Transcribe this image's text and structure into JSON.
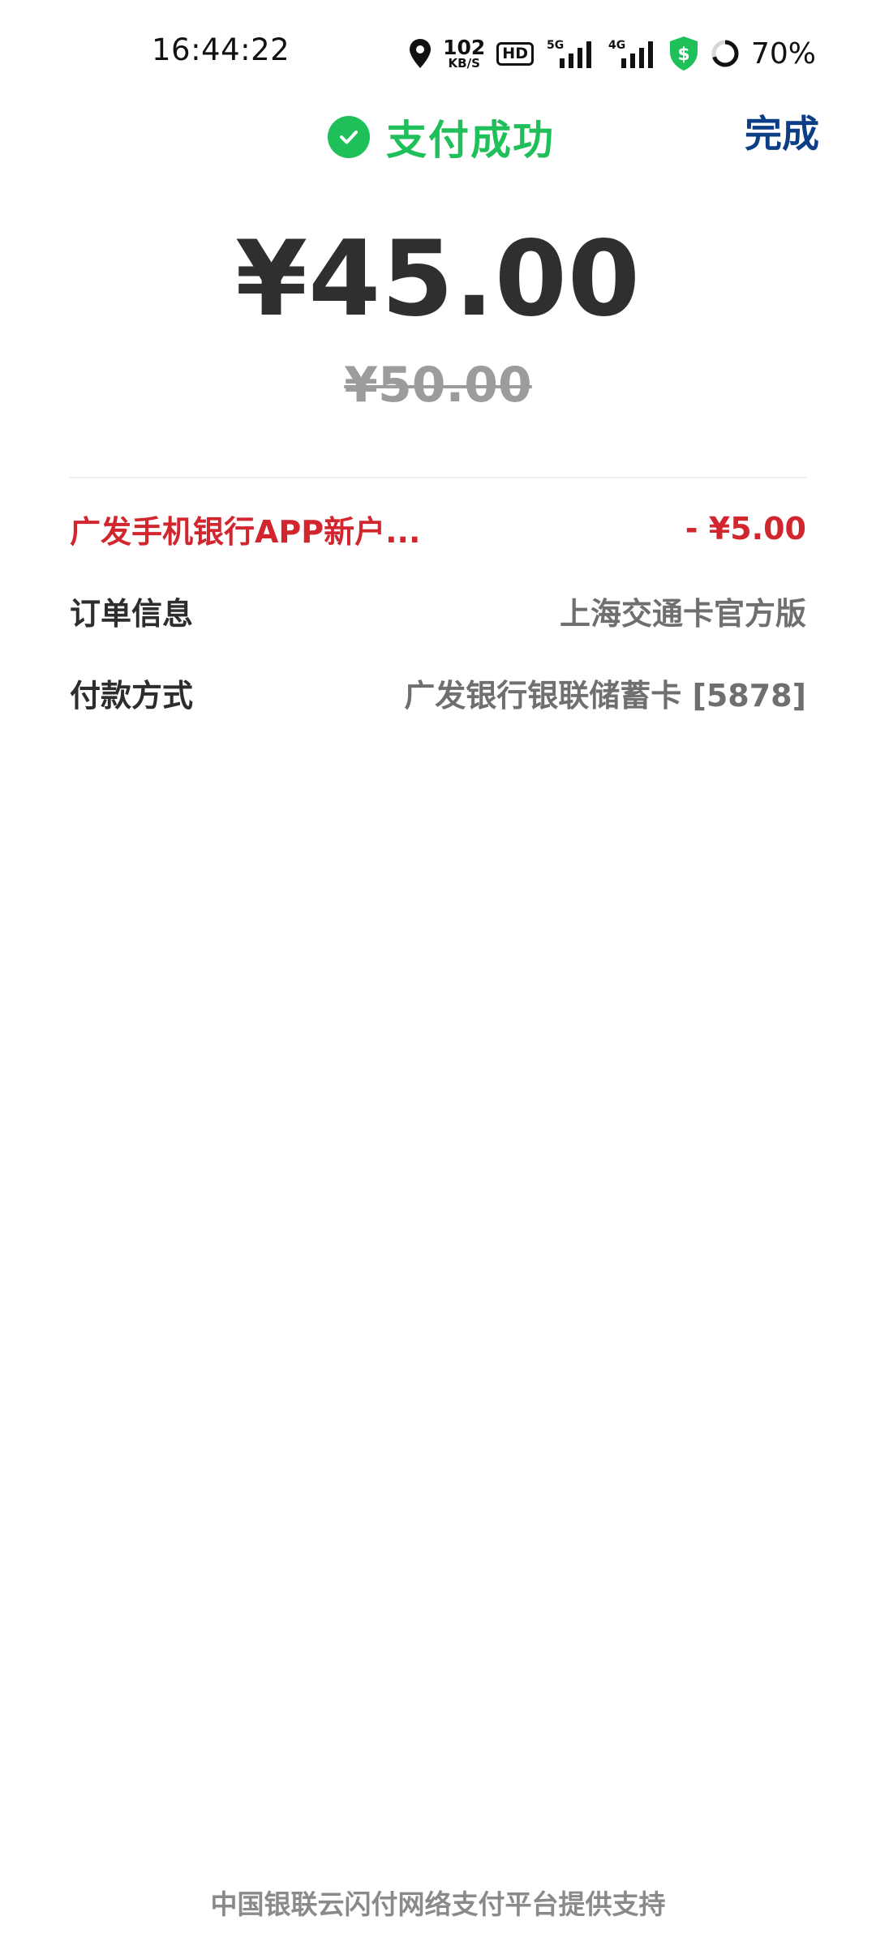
{
  "status_bar": {
    "time": "16:44:22",
    "net_speed_value": "102",
    "net_speed_unit": "KB/S",
    "hd_label": "HD",
    "signal1_label": "5G",
    "signal2_label": "4G",
    "battery": "70%",
    "icons": [
      "location-icon",
      "hd-icon",
      "signal-5g-icon",
      "signal-4g-icon",
      "security-shield-icon",
      "battery-ring-icon"
    ]
  },
  "header": {
    "title": "支付成功",
    "done_label": "完成",
    "accent_color": "#1fbf5a",
    "done_color": "#0d3d85"
  },
  "payment": {
    "amount": "¥45.00",
    "original_amount": "¥50.00"
  },
  "details": {
    "discount": {
      "label": "广发手机银行APP新户...",
      "value": "- ¥5.00"
    },
    "order": {
      "label": "订单信息",
      "value": "上海交通卡官方版"
    },
    "method": {
      "label": "付款方式",
      "value": "广发银行银联储蓄卡 [5878]"
    }
  },
  "footer": {
    "text": "中国银联云闪付网络支付平台提供支持"
  }
}
